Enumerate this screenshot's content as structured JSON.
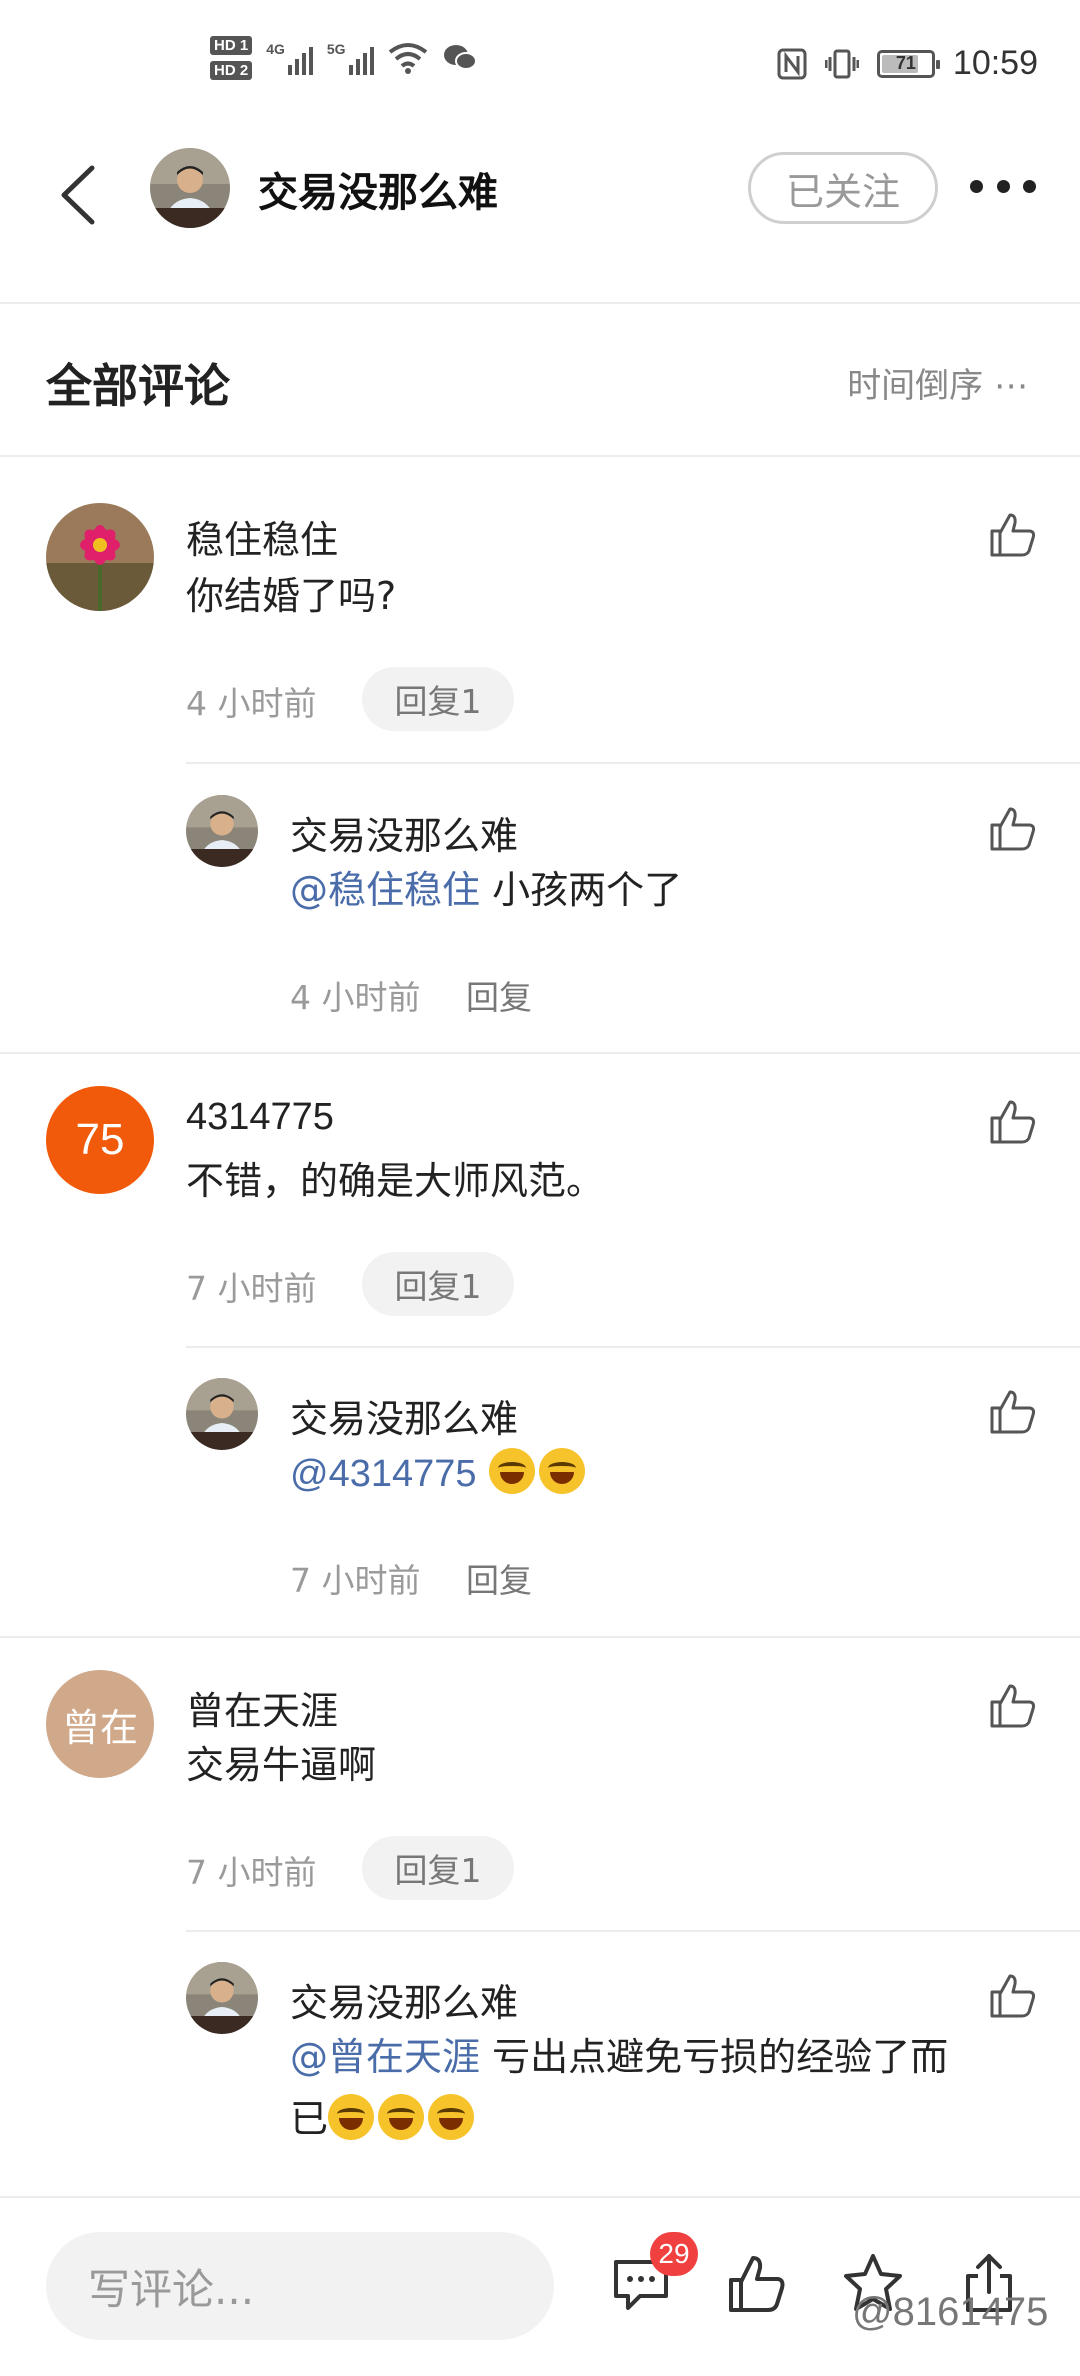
{
  "status_bar": {
    "hd1": "HD 1",
    "hd2": "HD 2",
    "net1": "4G",
    "net2": "5G",
    "battery": "71",
    "time": "10:59"
  },
  "header": {
    "username": "交易没那么难",
    "follow_label": "已关注"
  },
  "section": {
    "title": "全部评论",
    "sort_label": "时间倒序"
  },
  "comments": [
    {
      "name": "稳住稳住",
      "text": "你结婚了吗?",
      "time": "4 小时前",
      "reply_label": "回复1",
      "reply": {
        "name": "交易没那么难",
        "mention": "@稳住稳住",
        "text": "小孩两个了",
        "time": "4 小时前",
        "reply_label": "回复"
      }
    },
    {
      "name": "4314775",
      "avatar_text": "75",
      "text": "不错，的确是大师风范。",
      "time": "7 小时前",
      "reply_label": "回复1",
      "reply": {
        "name": "交易没那么难",
        "mention": "@4314775",
        "text": "",
        "time": "7 小时前",
        "reply_label": "回复"
      }
    },
    {
      "name": "曾在天涯",
      "avatar_text": "曾在",
      "text": "交易牛逼啊",
      "time": "7 小时前",
      "reply_label": "回复1",
      "reply": {
        "name": "交易没那么难",
        "mention": "@曾在天涯",
        "text": "亏出点避免亏损的经验了而",
        "text2": "已",
        "time": "",
        "reply_label": ""
      }
    }
  ],
  "bottom_bar": {
    "input_placeholder": "写评论...",
    "comment_count": "29",
    "watermark": "@8161475"
  },
  "colors": {
    "mention": "#4a6daa",
    "badge": "#f04040",
    "avatar_75": "#f05a0a",
    "avatar_zengzai": "#d0a88a"
  }
}
